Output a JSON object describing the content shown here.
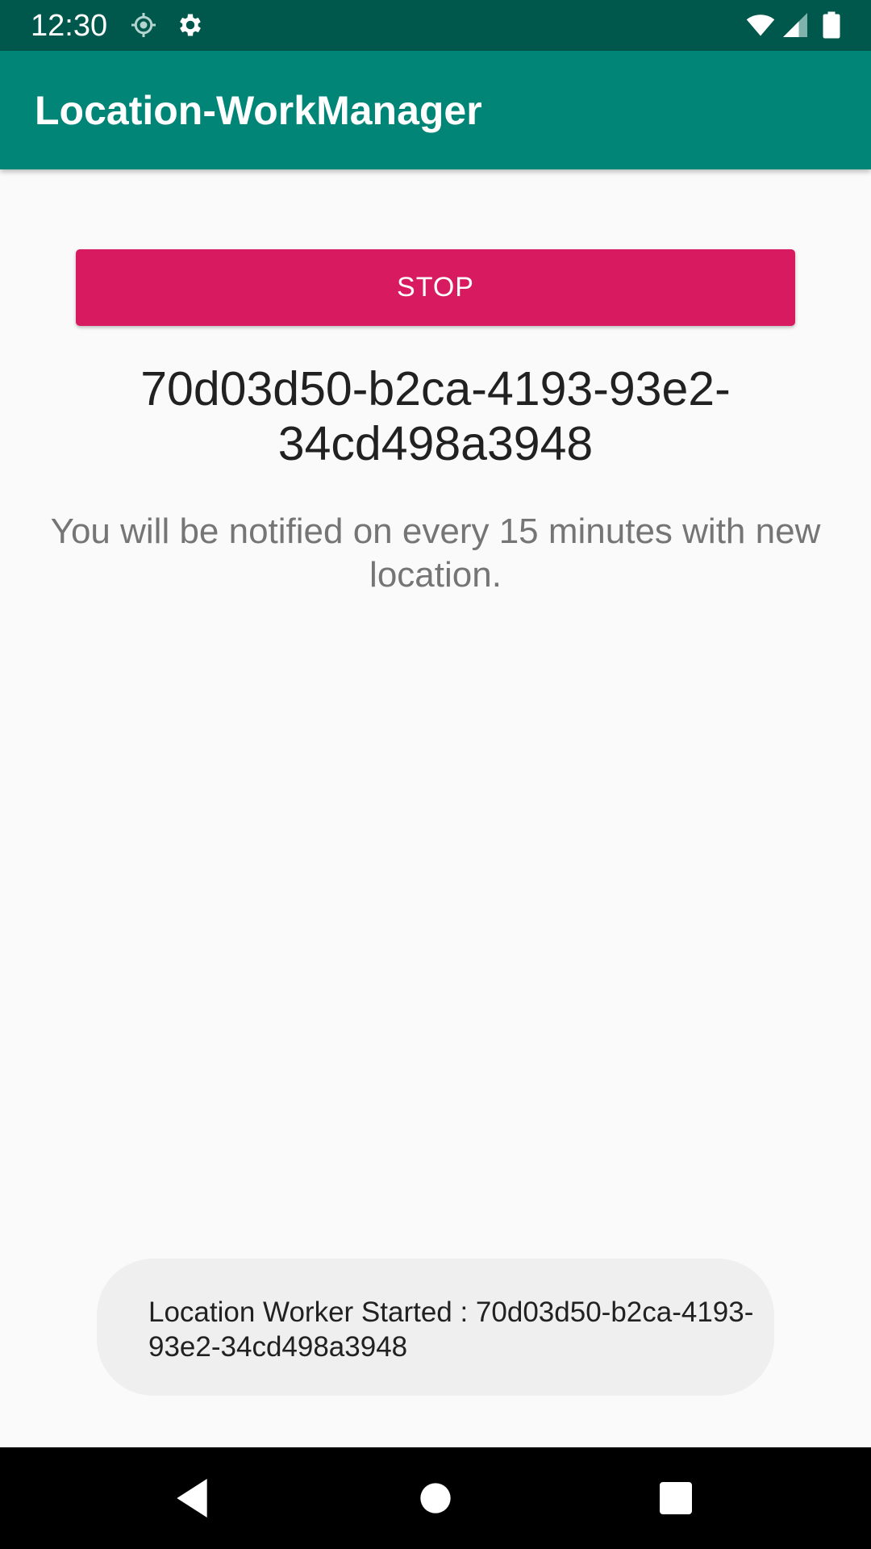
{
  "status_bar": {
    "time": "12:30",
    "icons_left": [
      "location-icon",
      "settings-icon"
    ],
    "icons_right": [
      "wifi-icon",
      "signal-icon",
      "battery-icon"
    ]
  },
  "app_bar": {
    "title": "Location-WorkManager"
  },
  "main": {
    "stop_button_label": "STOP",
    "work_id": "70d03d50-b2ca-4193-93e2-34cd498a3948",
    "notice": "You will be notified on every 15 minutes with new location."
  },
  "toast": {
    "message": "Location Worker Started : 70d03d50-b2ca-4193-93e2-34cd498a3948"
  },
  "nav_bar": {
    "buttons": [
      "back-icon",
      "home-icon",
      "recents-icon"
    ]
  },
  "colors": {
    "status_bar": "#00574b",
    "primary": "#008577",
    "accent": "#d81b60",
    "background": "#fafafa",
    "toast_bg": "#efefef"
  }
}
